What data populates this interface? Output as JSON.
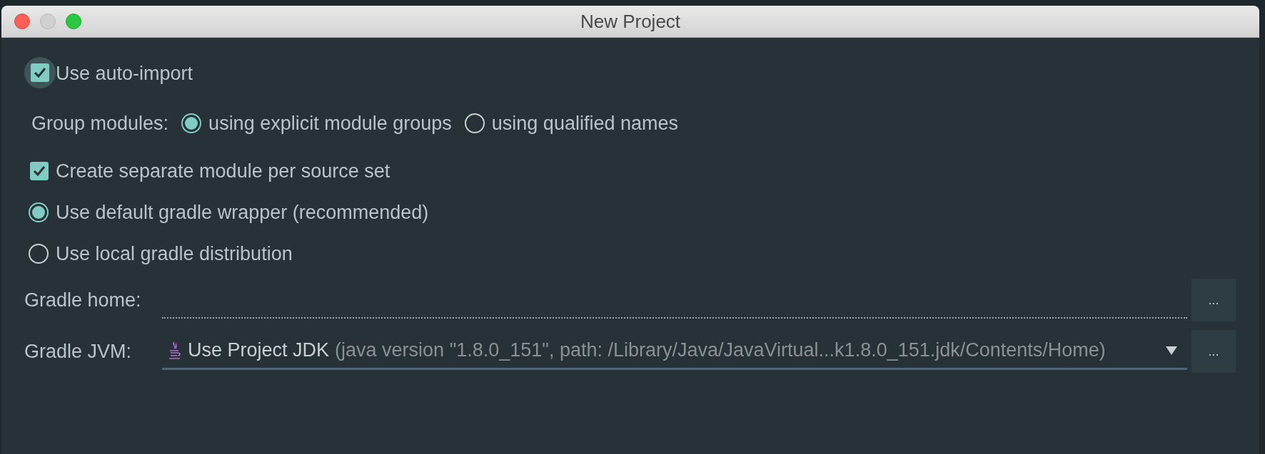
{
  "window": {
    "title": "New Project"
  },
  "options": [
    {
      "kind": "checkbox",
      "label": "Use auto-import",
      "checked": true,
      "focused": true
    },
    {
      "kind": "radio-group",
      "label": "Group modules:",
      "choices": [
        {
          "label": "using explicit module groups",
          "selected": true
        },
        {
          "label": "using qualified names",
          "selected": false
        }
      ]
    },
    {
      "kind": "checkbox",
      "label": "Create separate module per source set",
      "checked": true,
      "focused": false
    },
    {
      "kind": "radio",
      "label": "Use default gradle wrapper (recommended)",
      "selected": true
    },
    {
      "kind": "radio",
      "label": "Use local gradle distribution",
      "selected": false
    }
  ],
  "fields": [
    {
      "kind": "text",
      "label": "Gradle home:",
      "disabled": true,
      "browse": "..."
    },
    {
      "kind": "dropdown",
      "label": "Gradle JVM:",
      "value": "Use Project JDK",
      "detail": "(java version \"1.8.0_151\", path: /Library/Java/JavaVirtual...k1.8.0_151.jdk/Contents/Home)",
      "disabled": false,
      "browse": "..."
    }
  ]
}
